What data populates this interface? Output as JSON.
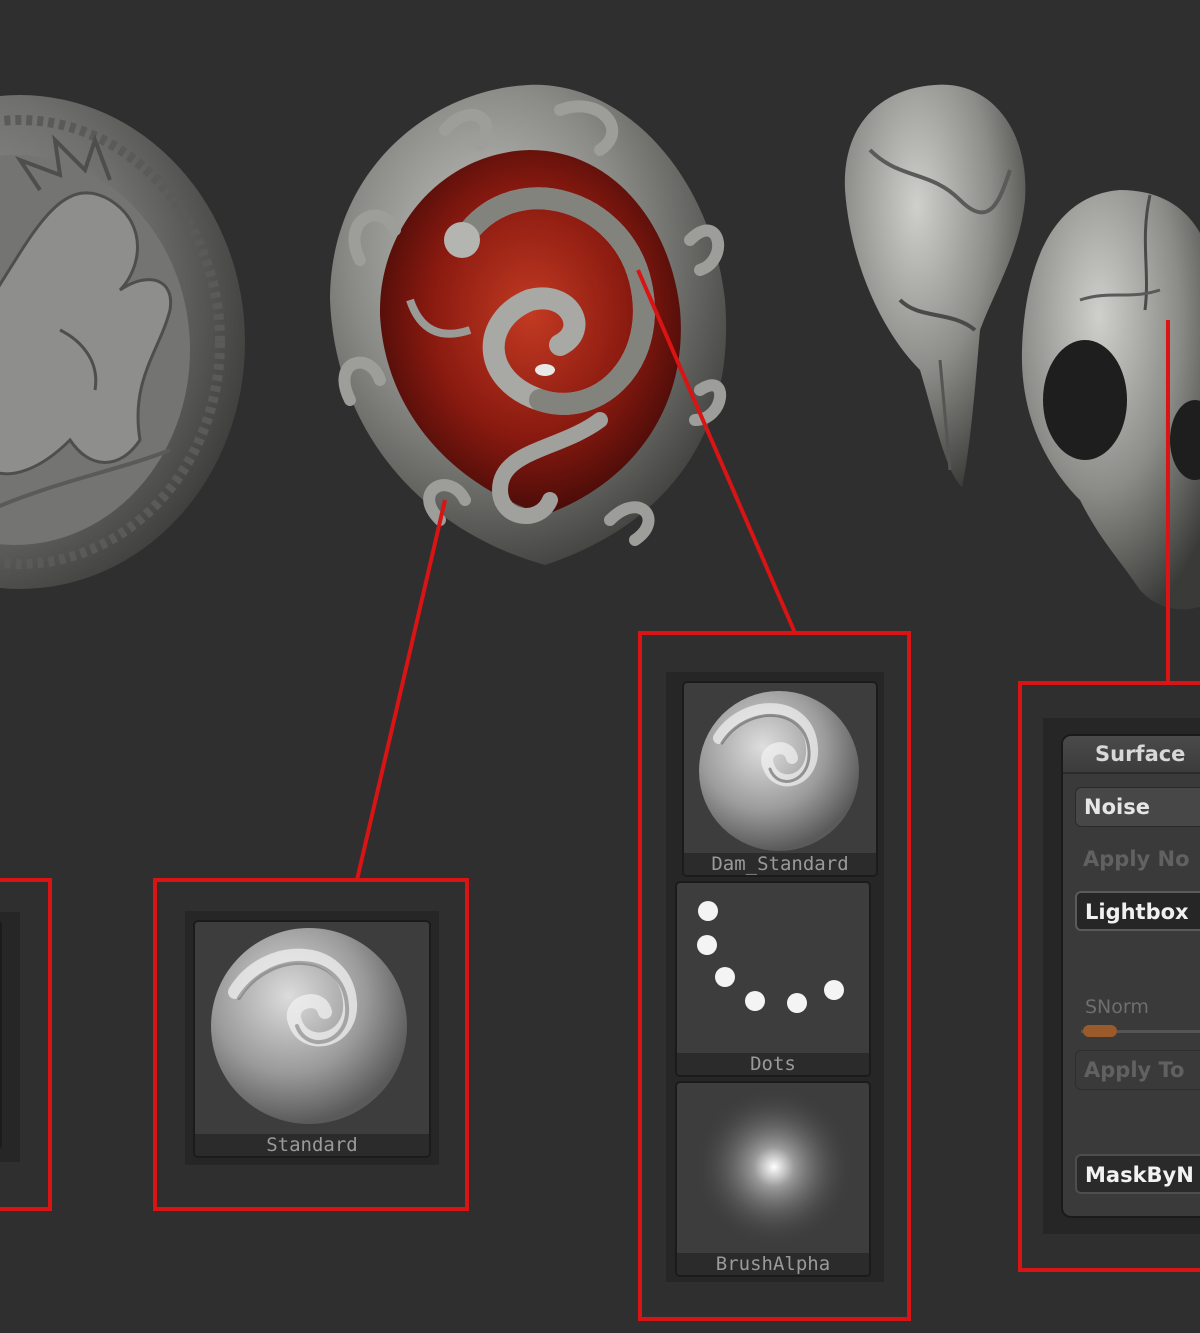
{
  "colors": {
    "background": "#2f2f2f",
    "callout_red": "#d81414",
    "gem_red": "#8a1a10",
    "metal": "#8a8a8a"
  },
  "callout_groups": [
    {
      "object": "coin-with-lion-relief",
      "brushes": []
    },
    {
      "object": "ornate-serpent-pendant-frame",
      "brushes": [
        "Standard"
      ]
    },
    {
      "object": "serpent-scales",
      "brushes": [
        "Dam_Standard",
        "Dots",
        "BrushAlpha"
      ]
    },
    {
      "object": "bird-skulls",
      "panel": "Surface"
    }
  ],
  "brushes": {
    "standard": {
      "label": "Standard",
      "icon": "standard-brush-icon"
    },
    "dam_standard": {
      "label": "Dam_Standard",
      "icon": "dam-standard-brush-icon"
    },
    "dots": {
      "label": "Dots",
      "icon": "dots-stroke-icon"
    },
    "brush_alpha": {
      "label": "BrushAlpha",
      "icon": "brush-alpha-icon"
    }
  },
  "surface_panel": {
    "title": "Surface",
    "noise_button": "Noise",
    "apply_noise_button": "Apply No",
    "lightbox_button": "Lightbox",
    "snorm_label": "SNorm",
    "snorm_value": 0.1,
    "apply_to_button": "Apply To",
    "maskbynoise_button": "MaskByN"
  }
}
